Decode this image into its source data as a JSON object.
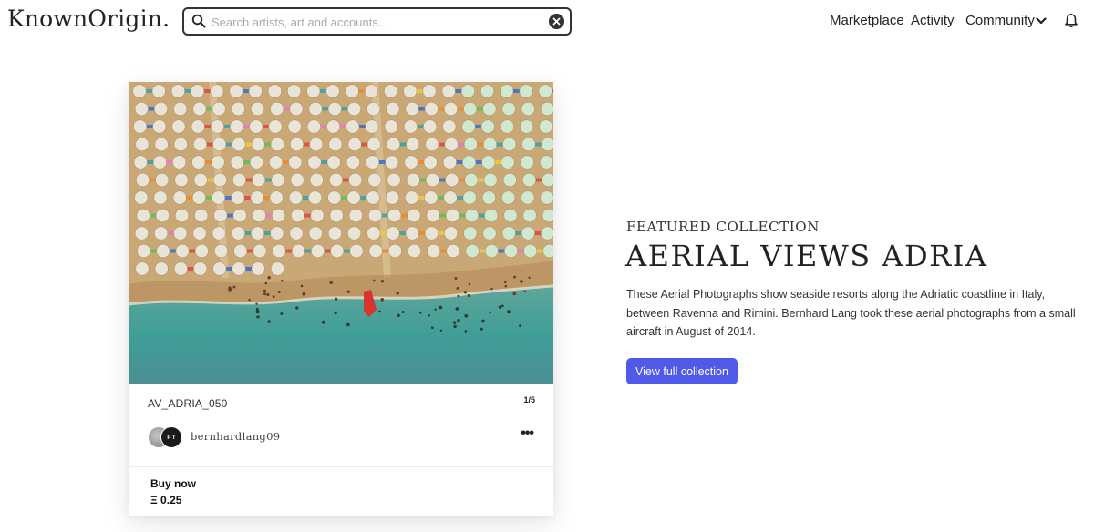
{
  "header": {
    "logo": "KnownOrigin.",
    "search": {
      "placeholder": "Search artists, art and accounts..."
    },
    "nav": {
      "marketplace": "Marketplace",
      "activity": "Activity",
      "community": "Community"
    },
    "icons": [
      "search-icon",
      "clear-icon",
      "chevron-down-icon",
      "bell-icon"
    ]
  },
  "card": {
    "artwork_name": "AV_ADRIA_050",
    "edition": "1/5",
    "artist": "bernhardlang09",
    "avatar_initials": "P T",
    "more_label": "•••",
    "buy_label": "Buy now",
    "price": "Ξ 0.25"
  },
  "featured": {
    "label": "FEATURED COLLECTION",
    "title": "AERIAL VIEWS ADRIA",
    "description": "These Aerial Photographs show seaside resorts along the Adriatic coastline in Italy, between Ravenna and Rimini. Bernhard Lang took these aerial photographs from a small aircraft in August of 2014.",
    "button": "View full collection"
  },
  "colors": {
    "accent": "#4f5ae8",
    "sand": "#c9a876",
    "sea": "#3f9e97",
    "umbrella_white": "#e9e4d8",
    "umbrella_mint": "#cfe8cf"
  }
}
